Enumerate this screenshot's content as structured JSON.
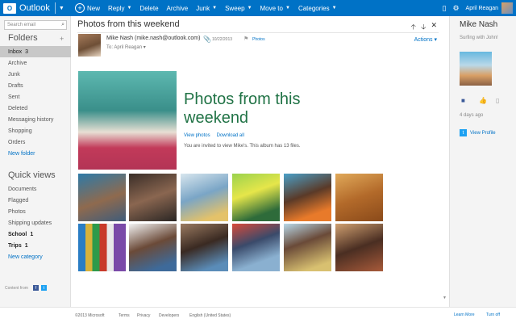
{
  "topbar": {
    "brand": "Outlook",
    "brand_mark": "O",
    "new_label": "New",
    "reply_label": "Reply",
    "delete_label": "Delete",
    "archive_label": "Archive",
    "junk_label": "Junk",
    "sweep_label": "Sweep",
    "move_to_label": "Move to",
    "categories_label": "Categories",
    "user_name": "April Reagan"
  },
  "left": {
    "search_placeholder": "Search email",
    "folders_heading": "Folders",
    "folders": [
      {
        "label": "Inbox",
        "count": "3"
      },
      {
        "label": "Archive"
      },
      {
        "label": "Junk"
      },
      {
        "label": "Drafts"
      },
      {
        "label": "Sent"
      },
      {
        "label": "Deleted"
      },
      {
        "label": "Messaging history"
      },
      {
        "label": "Shopping"
      },
      {
        "label": "Orders"
      }
    ],
    "new_folder": "New folder",
    "quick_views_heading": "Quick views",
    "quick_views": [
      {
        "label": "Documents"
      },
      {
        "label": "Flagged"
      },
      {
        "label": "Photos"
      },
      {
        "label": "Shipping updates"
      },
      {
        "label": "School",
        "count": "1"
      },
      {
        "label": "Trips",
        "count": "1"
      }
    ],
    "new_category": "New category"
  },
  "message": {
    "subject": "Photos from this weekend",
    "from": "Mike Nash (mike.nash@outlook.com)",
    "to": "To: April Reagan",
    "date": "10/22/2013",
    "tag": "Photos",
    "actions_label": "Actions",
    "hero_title": "Photos from this weekend",
    "view_photos": "View photos",
    "download_all": "Download all",
    "description": "You are invited to view Mike's. This album has 13 files."
  },
  "contact": {
    "name": "Mike Nash",
    "status": "Surfing with John!",
    "ago": "4 days ago",
    "view_profile": "View Profile",
    "content_from": "Content from",
    "learn_more": "Learn More",
    "turn_off": "Turn off"
  },
  "footer": {
    "copyright": "©2013 Microsoft",
    "terms": "Terms",
    "privacy": "Privacy",
    "developers": "Developers",
    "language": "English (United States)"
  },
  "colors": {
    "brand_blue": "#0072c6",
    "title_green": "#217346",
    "pane_gray": "#f4f4f4"
  }
}
